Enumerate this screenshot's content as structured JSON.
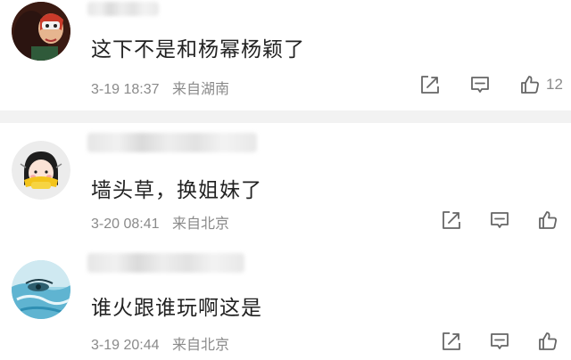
{
  "comments": [
    {
      "text": "这下不是和杨幂杨颖了",
      "date": "3-19 18:37",
      "location": "来自湖南",
      "like_count": "12"
    },
    {
      "text": "墙头草，换姐妹了",
      "date": "3-20 08:41",
      "location": "来自北京",
      "like_count": ""
    },
    {
      "text": "谁火跟谁玩啊这是",
      "date": "3-19 20:44",
      "location": "来自北京",
      "like_count": ""
    }
  ],
  "icons": {
    "share": "share-icon",
    "comment": "comment-icon",
    "like": "thumbs-up-icon"
  },
  "colors": {
    "text": "#222222",
    "meta": "#8a8a8a",
    "divider": "#f2f2f2"
  }
}
